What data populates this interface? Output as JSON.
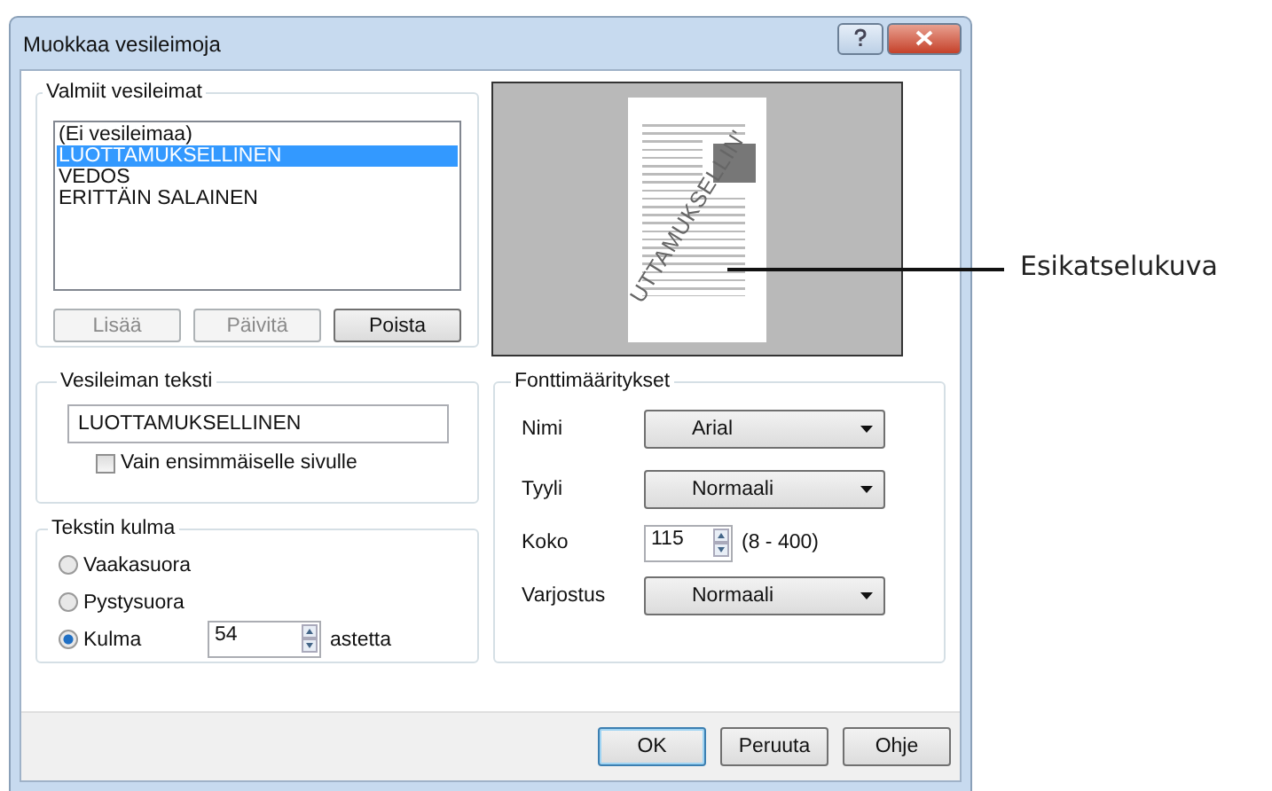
{
  "window": {
    "title": "Muokkaa vesileimoja"
  },
  "presets": {
    "title": "Valmiit vesileimat",
    "items": [
      {
        "label": "(Ei vesileimaa)",
        "selected": false
      },
      {
        "label": "LUOTTAMUKSELLINEN",
        "selected": true
      },
      {
        "label": "VEDOS",
        "selected": false
      },
      {
        "label": "ERITTÄIN SALAINEN",
        "selected": false
      }
    ],
    "buttons": [
      {
        "label": "Lisää",
        "disabled": true
      },
      {
        "label": "Päivitä",
        "disabled": true
      },
      {
        "label": "Poista",
        "disabled": false
      }
    ]
  },
  "preview": {
    "watermark": "UTTAMUKSELLIN'"
  },
  "callout": {
    "label": "Esikatselukuva"
  },
  "watermark_text": {
    "title": "Vesileiman teksti",
    "value": "LUOTTAMUKSELLINEN",
    "first_page_only": {
      "label": "Vain ensimmäiselle sivulle",
      "checked": false
    }
  },
  "angle": {
    "title": "Tekstin kulma",
    "options": [
      {
        "label": "Vaakasuora",
        "selected": false
      },
      {
        "label": "Pystysuora",
        "selected": false
      },
      {
        "label": "Kulma",
        "selected": true
      }
    ],
    "value": "54",
    "unit": "astetta"
  },
  "font": {
    "title": "Fonttimääritykset",
    "rows": [
      {
        "kind": "select",
        "label": "Nimi",
        "value": "Arial"
      },
      {
        "kind": "select",
        "label": "Tyyli",
        "value": "Normaali"
      },
      {
        "kind": "spin",
        "label": "Koko",
        "value": "115",
        "range": "(8 - 400)"
      },
      {
        "kind": "select",
        "label": "Varjostus",
        "value": "Normaali"
      }
    ]
  },
  "footer": [
    {
      "label": "OK",
      "focused": true
    },
    {
      "label": "Peruuta",
      "focused": false
    },
    {
      "label": "Ohje",
      "focused": false
    }
  ]
}
